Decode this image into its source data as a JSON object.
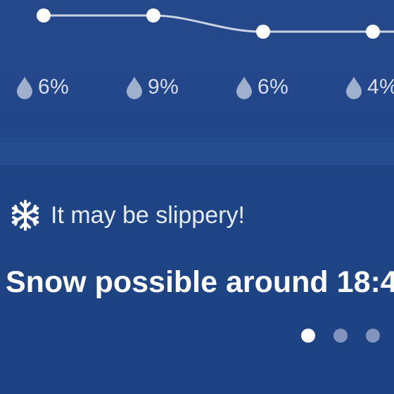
{
  "forecast": {
    "precipitation": [
      {
        "value": "6%",
        "icon": "raindrop-icon"
      },
      {
        "value": "9%",
        "icon": "raindrop-icon"
      },
      {
        "value": "6%",
        "icon": "raindrop-icon"
      },
      {
        "value": "4%",
        "icon": "raindrop-icon"
      }
    ],
    "temperature_trend": "flat-then-lower"
  },
  "alert": {
    "icon": "snowflake-icon",
    "label": "It may be slippery!",
    "headline": "Snow possible around 18:4"
  },
  "pager": {
    "count": 3,
    "active_index": 0
  },
  "colors": {
    "background": "#1f4383",
    "text": "#ffffff",
    "muted_text": "#d7dfec",
    "drop": "#9fb0cc",
    "inactive_dot": "#7f95bd"
  }
}
